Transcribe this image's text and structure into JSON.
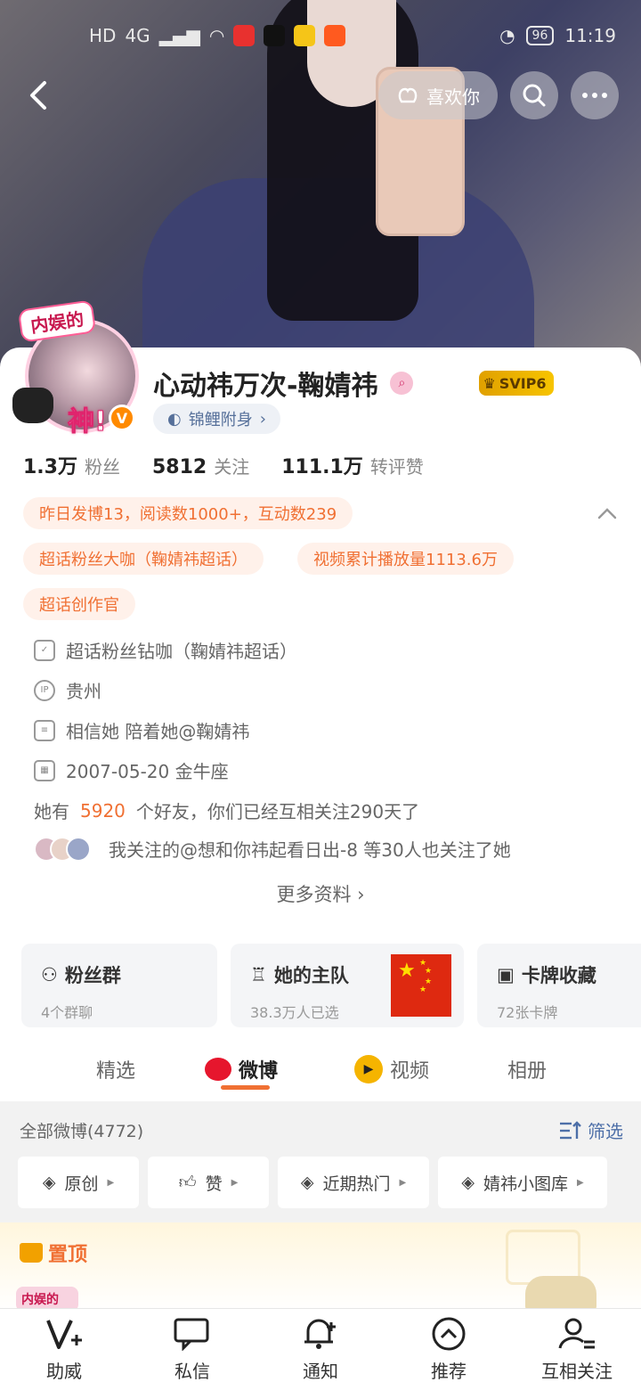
{
  "status_bar": {
    "left_indicators": [
      "HD",
      "4G"
    ],
    "time": "11:19",
    "battery": "96"
  },
  "header": {
    "like_label": "喜欢你"
  },
  "profile": {
    "name": "心动祎万次-鞠婧祎",
    "svip_label": "SVIP6",
    "koi_label": "锦鲤附身",
    "avatar_frame_top": "内娱的",
    "avatar_frame_bottom": "神!",
    "verified_mark": "V"
  },
  "stats": [
    {
      "value": "1.3万",
      "label": "粉丝"
    },
    {
      "value": "5812",
      "label": "关注"
    },
    {
      "value": "111.1万",
      "label": "转评赞"
    }
  ],
  "pills": [
    "昨日发博13，阅读数1000+，互动数239",
    "超话粉丝大咖（鞠婧祎超话）",
    "视频累计播放量1113.6万",
    "超话创作官"
  ],
  "info": {
    "superfan": "超话粉丝钻咖（鞠婧祎超话）",
    "ip_label": "IP",
    "location": "贵州",
    "bio": "相信她 陪着她@鞠婧祎",
    "birthday": "2007-05-20 金牛座",
    "friends_prefix": "她有",
    "friends_count": "5920",
    "friends_suffix": "个好友，你们已经互相关注290天了",
    "followers_note": "我关注的@想和你祎起看日出-8 等30人也关注了她",
    "more_label": "更多资料"
  },
  "feature_cards": [
    {
      "title": "粉丝群",
      "sub": "4个群聊"
    },
    {
      "title": "她的主队",
      "sub": "38.3万人已选"
    },
    {
      "title": "卡牌收藏",
      "sub": "72张卡牌"
    }
  ],
  "tabs": [
    "精选",
    "微博",
    "视频",
    "相册"
  ],
  "feed": {
    "title": "全部微博(4772)",
    "filter_label": "筛选",
    "chips": [
      "原创",
      "赞",
      "近期热门",
      "婧祎小图库"
    ]
  },
  "pinned": {
    "label": "置顶",
    "peek_text": "内娱的"
  },
  "bottom_nav": [
    "助威",
    "私信",
    "通知",
    "推荐",
    "互相关注"
  ],
  "colors": {
    "accent": "#f07033",
    "link_blue": "#4d6fa8",
    "svip_gold": "#f7c400"
  }
}
